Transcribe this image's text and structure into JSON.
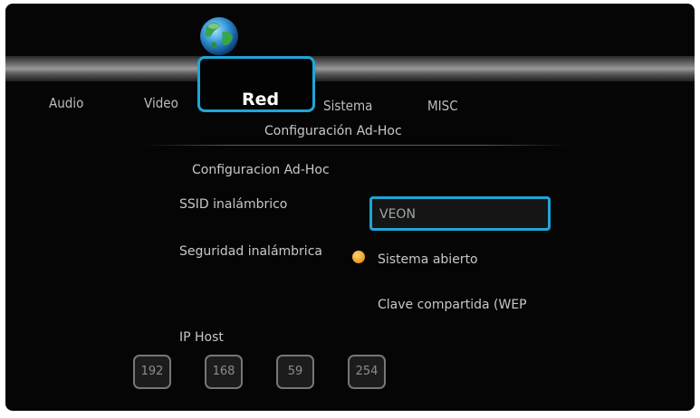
{
  "tabs": {
    "audio": "Audio",
    "video": "Video",
    "red": "Red",
    "sistema": "Sistema",
    "misc": "MISC"
  },
  "subtitle": "Configuración Ad-Hoc",
  "section_title": "Configuracion Ad-Hoc",
  "ssid": {
    "label": "SSID inalámbrico",
    "value": "VEON"
  },
  "security": {
    "label": "Seguridad inalámbrica",
    "options": [
      "Sistema abierto",
      "Clave compartida (WEP"
    ],
    "selected": "Sistema abierto"
  },
  "ip_host": {
    "label": "IP Host",
    "octets": [
      "192",
      "168",
      "59",
      "254"
    ]
  },
  "colors": {
    "accent": "#1ea6d6",
    "radio_selected": "#e89a16",
    "background": "#050505"
  },
  "icons": {
    "network_tab": "globe-icon",
    "radio": "radio-selected-icon"
  }
}
